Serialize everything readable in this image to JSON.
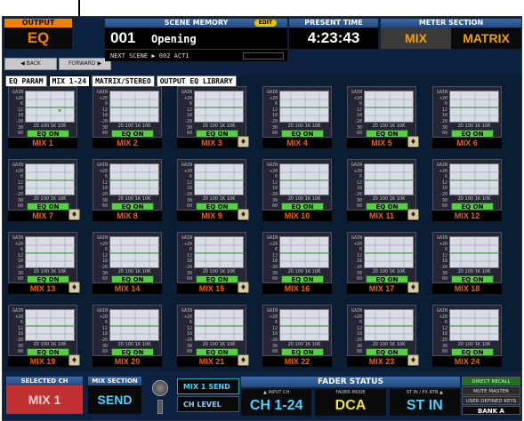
{
  "header": {
    "output": {
      "label": "OUTPUT",
      "value": "EQ"
    },
    "nav": {
      "back": "◀ BACK",
      "forward": "FORWARD ▶"
    },
    "scene": {
      "label": "SCENE MEMORY",
      "edit": "EDIT",
      "number": "001",
      "title": "Opening",
      "next_label": "NEXT SCENE",
      "next": "▶ 002 ACT1"
    },
    "time": {
      "label": "PRESENT TIME",
      "value": "4:23:43"
    },
    "meter": {
      "label": "METER SECTION",
      "mix": "MIX",
      "matrix": "MATRIX"
    }
  },
  "tabs": [
    {
      "label": "EQ PARAM"
    },
    {
      "label": "MIX 1-24"
    },
    {
      "label": "MATRIX/STEREO"
    },
    {
      "label": "OUTPUT EQ LIBRARY"
    }
  ],
  "eq_scale": [
    "GAIN",
    "+20",
    "6",
    "12",
    "18",
    "-20",
    "30",
    "60"
  ],
  "freq_scale": "20 100   1K   10K",
  "eq_button": "EQ ON",
  "library_icon": "library-icon",
  "mixes": [
    {
      "name": "MIX 1",
      "lib": false
    },
    {
      "name": "MIX 2",
      "lib": false
    },
    {
      "name": "MIX 3",
      "lib": true
    },
    {
      "name": "MIX 4",
      "lib": false
    },
    {
      "name": "MIX 5",
      "lib": true
    },
    {
      "name": "MIX 6",
      "lib": false
    },
    {
      "name": "MIX 7",
      "lib": true
    },
    {
      "name": "MIX 8",
      "lib": false
    },
    {
      "name": "MIX 9",
      "lib": true
    },
    {
      "name": "MIX 10",
      "lib": false
    },
    {
      "name": "MIX 11",
      "lib": true
    },
    {
      "name": "MIX 12",
      "lib": false
    },
    {
      "name": "MIX 13",
      "lib": true
    },
    {
      "name": "MIX 14",
      "lib": false
    },
    {
      "name": "MIX 15",
      "lib": true
    },
    {
      "name": "MIX 16",
      "lib": false
    },
    {
      "name": "MIX 17",
      "lib": true
    },
    {
      "name": "MIX 18",
      "lib": false
    },
    {
      "name": "MIX 19",
      "lib": true
    },
    {
      "name": "MIX 20",
      "lib": false
    },
    {
      "name": "MIX 21",
      "lib": true
    },
    {
      "name": "MIX 22",
      "lib": false
    },
    {
      "name": "MIX 23",
      "lib": true
    },
    {
      "name": "MIX 24",
      "lib": false
    }
  ],
  "footer": {
    "selected": {
      "label": "SELECTED CH",
      "value": "MIX 1"
    },
    "mix_section": {
      "label": "MIX SECTION",
      "value": "SEND"
    },
    "send": {
      "mix_send": "MIX 1 SEND",
      "ch_level": "CH LEVEL"
    },
    "fader": {
      "label": "FADER STATUS",
      "input_label": "▲ INPUT CH",
      "input_value": "CH 1-24",
      "mode_label": "FADER MODE",
      "mode_value": "DCA",
      "st_label": "ST IN / FX RTN ▲",
      "st_value": "ST IN"
    },
    "right": {
      "direct_recall": "DIRECT RECALL",
      "mute_master": "MUTE MASTER",
      "user_keys": "USER DEFINED KEYS",
      "bank": "BANK A"
    }
  },
  "colors": {
    "accent_orange": "#f08000",
    "eq_on_green": "#54d040",
    "cyan": "#4cd2ff",
    "selected_red": "#c03030"
  }
}
